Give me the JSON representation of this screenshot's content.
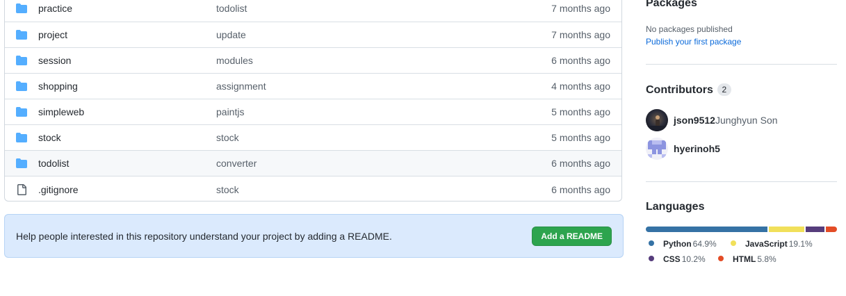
{
  "files": [
    {
      "name": "practice",
      "type": "folder",
      "message": "todolist",
      "age": "7 months ago"
    },
    {
      "name": "project",
      "type": "folder",
      "message": "update",
      "age": "7 months ago"
    },
    {
      "name": "session",
      "type": "folder",
      "message": "modules",
      "age": "6 months ago"
    },
    {
      "name": "shopping",
      "type": "folder",
      "message": "assignment",
      "age": "4 months ago"
    },
    {
      "name": "simpleweb",
      "type": "folder",
      "message": "paintjs",
      "age": "5 months ago"
    },
    {
      "name": "stock",
      "type": "folder",
      "message": "stock",
      "age": "5 months ago"
    },
    {
      "name": "todolist",
      "type": "folder",
      "message": "converter",
      "age": "6 months ago"
    },
    {
      "name": ".gitignore",
      "type": "file",
      "message": "stock",
      "age": "6 months ago"
    }
  ],
  "readme_banner": {
    "text": "Help people interested in this repository understand your project by adding a README.",
    "button_label": "Add a README"
  },
  "sidebar": {
    "packages": {
      "heading": "Packages",
      "empty_text": "No packages published",
      "link": "Publish your first package"
    },
    "contributors": {
      "heading": "Contributors",
      "count": "2",
      "list": [
        {
          "login": "json9512",
          "name": "Junghyun Son"
        },
        {
          "login": "hyerinoh5",
          "name": ""
        }
      ]
    },
    "languages": {
      "heading": "Languages",
      "items": [
        {
          "name": "Python",
          "percent": "64.9%",
          "color": "#3572A5"
        },
        {
          "name": "JavaScript",
          "percent": "19.1%",
          "color": "#f1e05a"
        },
        {
          "name": "CSS",
          "percent": "10.2%",
          "color": "#563d7c"
        },
        {
          "name": "HTML",
          "percent": "5.8%",
          "color": "#e34c26"
        }
      ]
    }
  }
}
